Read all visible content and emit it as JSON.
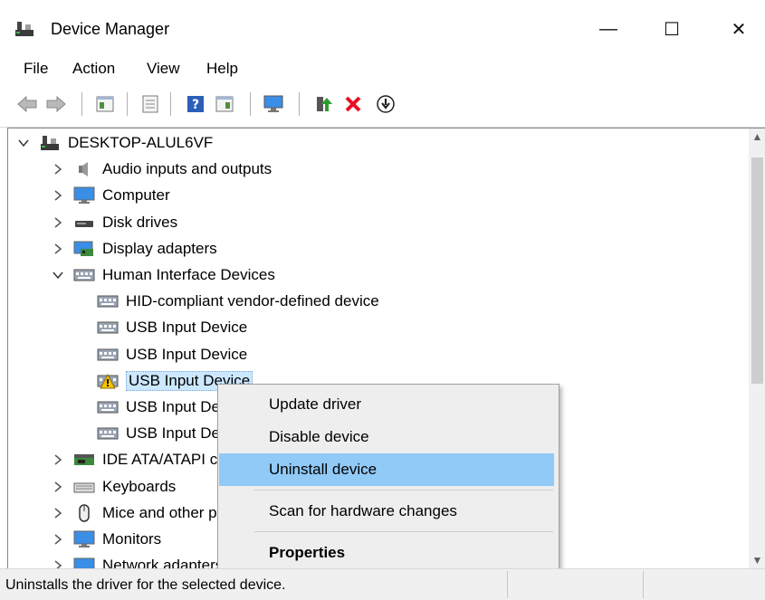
{
  "window": {
    "title": "Device Manager",
    "minimize": "—",
    "maximize": "☐",
    "close": "✕"
  },
  "menubar": [
    "File",
    "Action",
    "View",
    "Help"
  ],
  "toolbar": [
    {
      "name": "back-icon",
      "glyph": "⇦"
    },
    {
      "name": "forward-icon",
      "glyph": "⇨"
    },
    {
      "name": "properties-pane-icon",
      "glyph": "▤"
    },
    {
      "name": "show-hide-console-tree-icon",
      "glyph": "▥"
    },
    {
      "name": "help-icon",
      "glyph": "?"
    },
    {
      "name": "action-pane-icon",
      "glyph": "▦"
    },
    {
      "name": "monitor-icon",
      "glyph": "🖵"
    },
    {
      "name": "update-driver-icon",
      "glyph": "⬆"
    },
    {
      "name": "uninstall-device-icon",
      "glyph": "✕"
    },
    {
      "name": "download-icon",
      "glyph": "⬇"
    }
  ],
  "tree": [
    {
      "label": "DESKTOP-ALUL6VF",
      "level": 0,
      "expanded": true,
      "icon": "computer-tree-icon"
    },
    {
      "label": "Audio inputs and outputs",
      "level": 1,
      "expanded": false,
      "icon": "speaker-icon"
    },
    {
      "label": "Computer",
      "level": 1,
      "expanded": false,
      "icon": "monitor-icon"
    },
    {
      "label": "Disk drives",
      "level": 1,
      "expanded": false,
      "icon": "disk-drive-icon"
    },
    {
      "label": "Display adapters",
      "level": 1,
      "expanded": false,
      "icon": "display-adapter-icon"
    },
    {
      "label": "Human Interface Devices",
      "level": 1,
      "expanded": true,
      "icon": "hid-icon"
    },
    {
      "label": "HID-compliant vendor-defined device",
      "level": 2,
      "icon": "hid-icon"
    },
    {
      "label": "USB Input Device",
      "level": 2,
      "icon": "hid-icon"
    },
    {
      "label": "USB Input Device",
      "level": 2,
      "icon": "hid-icon"
    },
    {
      "label": "USB Input Device",
      "level": 2,
      "icon": "hid-warning-icon",
      "selected": true
    },
    {
      "label": "USB Input Device",
      "level": 2,
      "icon": "hid-icon"
    },
    {
      "label": "USB Input Device",
      "level": 2,
      "icon": "hid-icon"
    },
    {
      "label": "IDE ATA/ATAPI controllers",
      "level": 1,
      "expanded": false,
      "icon": "ide-controller-icon"
    },
    {
      "label": "Keyboards",
      "level": 1,
      "expanded": false,
      "icon": "keyboard-icon"
    },
    {
      "label": "Mice and other pointing devices",
      "level": 1,
      "expanded": false,
      "icon": "mouse-icon"
    },
    {
      "label": "Monitors",
      "level": 1,
      "expanded": false,
      "icon": "monitor-icon"
    },
    {
      "label": "Network adapters",
      "level": 1,
      "expanded": false,
      "icon": "network-adapter-icon"
    }
  ],
  "context_menu": [
    {
      "label": "Update driver"
    },
    {
      "label": "Disable device"
    },
    {
      "label": "Uninstall device",
      "hover": true
    },
    {
      "separator": true
    },
    {
      "label": "Scan for hardware changes"
    },
    {
      "separator": true
    },
    {
      "label": "Properties",
      "bold": true
    }
  ],
  "status": {
    "text": "Uninstalls the driver for the selected device."
  },
  "colors": {
    "selection": "#cce8ff",
    "menu_hover": "#91c9f7",
    "warning": "#f5c400",
    "uninstall_red": "#e81123",
    "update_green": "#2e9b2e"
  }
}
